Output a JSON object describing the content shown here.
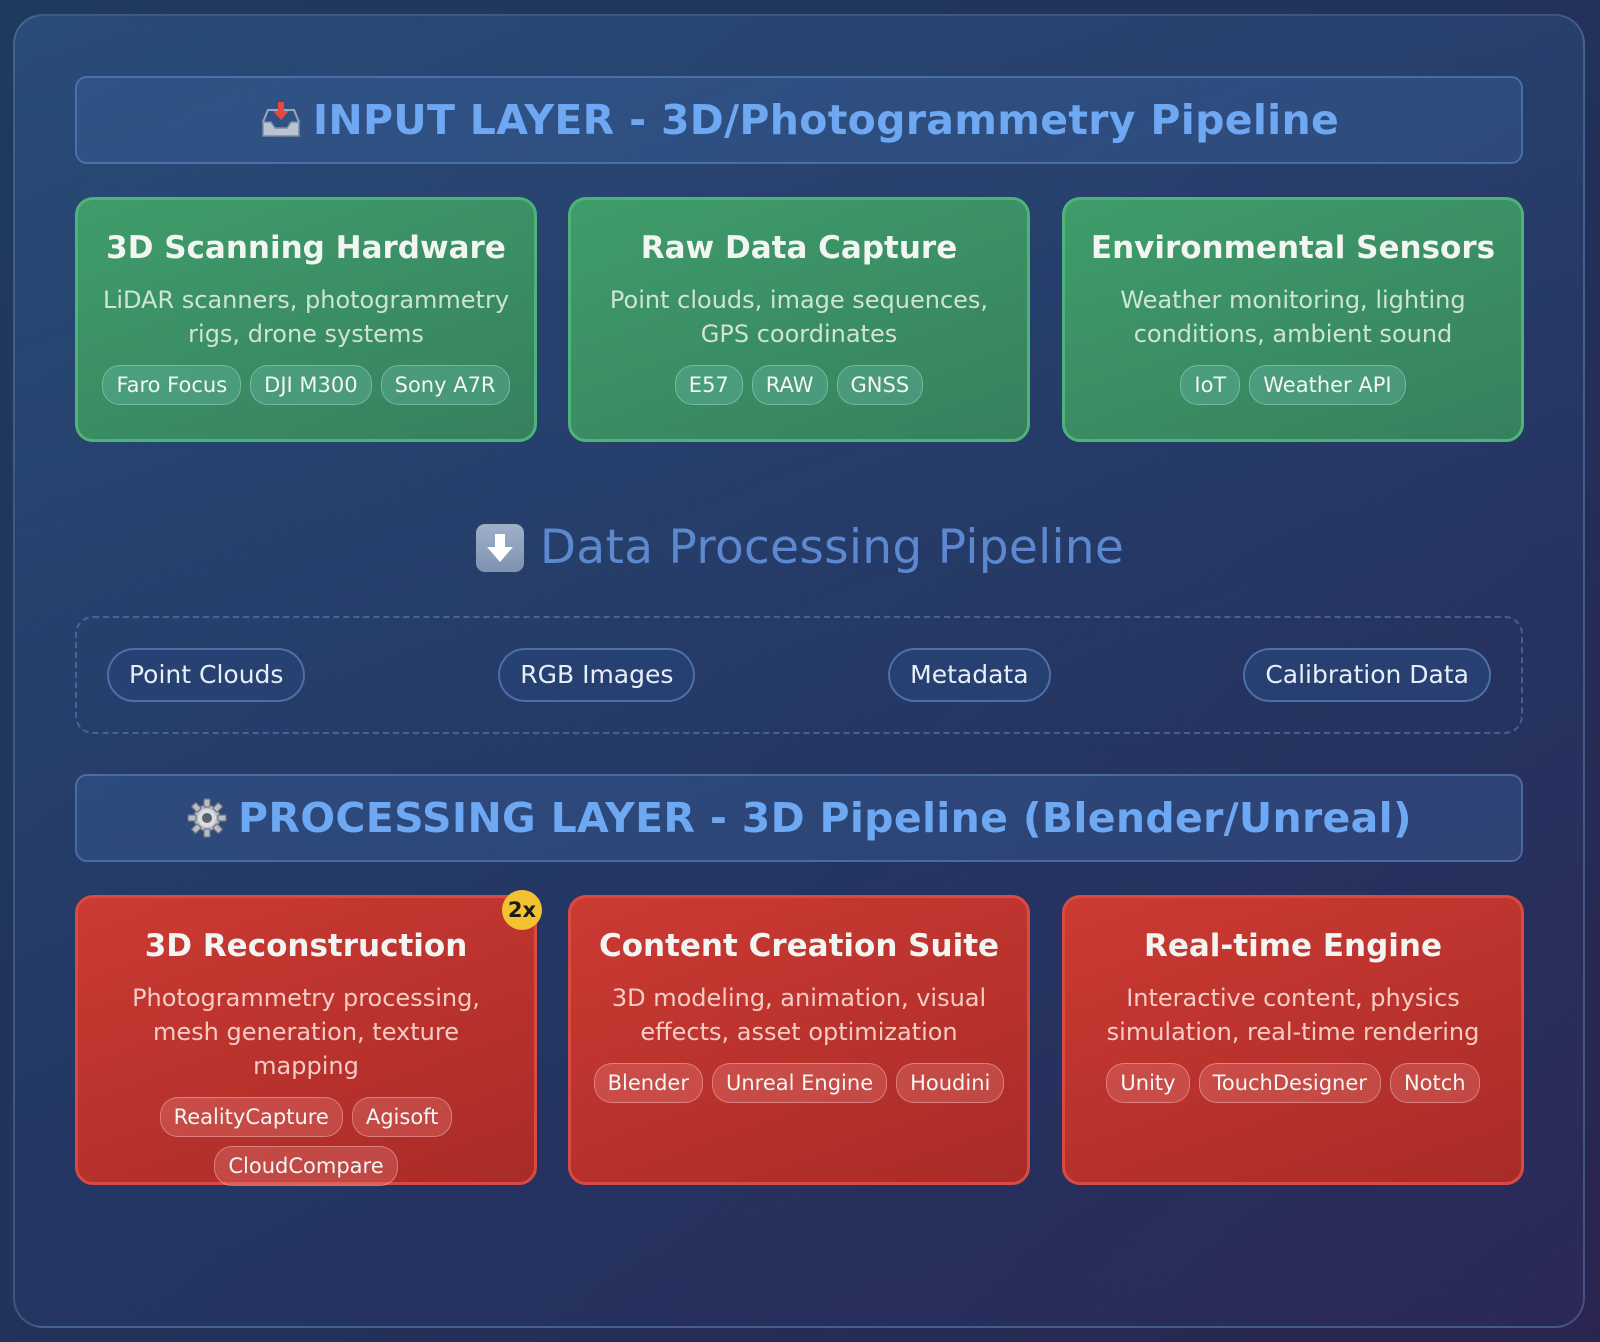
{
  "input_layer": {
    "icon": "inbox-tray-icon",
    "title": "INPUT LAYER - 3D/Photogrammetry Pipeline",
    "cards": [
      {
        "title": "3D Scanning Hardware",
        "description": "LiDAR scanners, photogrammetry rigs, drone systems",
        "tags": [
          "Faro Focus",
          "DJI M300",
          "Sony A7R"
        ]
      },
      {
        "title": "Raw Data Capture",
        "description": "Point clouds, image sequences, GPS coordinates",
        "tags": [
          "E57",
          "RAW",
          "GNSS"
        ]
      },
      {
        "title": "Environmental Sensors",
        "description": "Weather monitoring, lighting conditions, ambient sound",
        "tags": [
          "IoT",
          "Weather API"
        ]
      }
    ]
  },
  "flow": {
    "icon": "down-arrow-icon",
    "label": "Data Processing Pipeline",
    "items": [
      "Point Clouds",
      "RGB Images",
      "Metadata",
      "Calibration Data"
    ]
  },
  "processing_layer": {
    "icon": "gear-icon",
    "title": "PROCESSING LAYER - 3D Pipeline (Blender/Unreal)",
    "cards": [
      {
        "title": "3D Reconstruction",
        "description": "Photogrammetry processing, mesh generation, texture mapping",
        "tags": [
          "RealityCapture",
          "Agisoft",
          "CloudCompare"
        ],
        "badge": "2x"
      },
      {
        "title": "Content Creation Suite",
        "description": "3D modeling, animation, visual effects, asset optimization",
        "tags": [
          "Blender",
          "Unreal Engine",
          "Houdini"
        ]
      },
      {
        "title": "Real-time Engine",
        "description": "Interactive content, physics simulation, real-time rendering",
        "tags": [
          "Unity",
          "TouchDesigner",
          "Notch"
        ]
      }
    ]
  },
  "colors": {
    "header_text": "#6ea8f2",
    "input_card": "#3f9d6a",
    "processing_card": "#cc3a33",
    "badge": "#f2c230",
    "flow_text": "#5b88cf"
  }
}
